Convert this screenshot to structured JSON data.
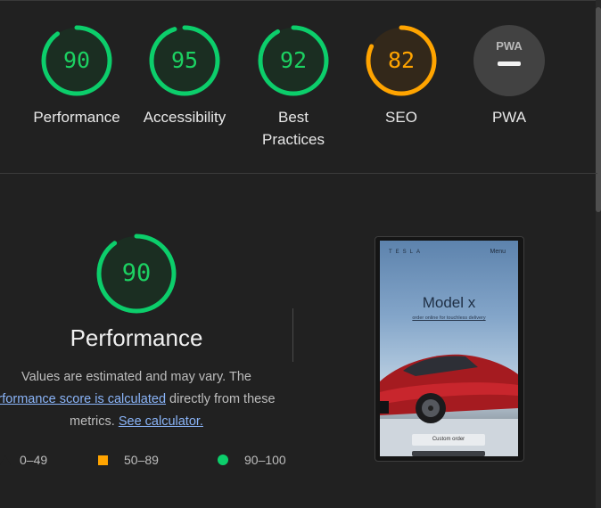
{
  "categories": [
    {
      "label": "Performance",
      "score": "90",
      "value": 90,
      "color": "#0cce6b"
    },
    {
      "label": "Accessibility",
      "score": "95",
      "value": 95,
      "color": "#0cce6b"
    },
    {
      "label": "Best\nPractices",
      "label_line1": "Best",
      "label_line2": "Practices",
      "score": "92",
      "value": 92,
      "color": "#0cce6b"
    },
    {
      "label": "SEO",
      "score": "82",
      "value": 82,
      "color": "#ffa400"
    },
    {
      "label": "PWA",
      "badge": "PWA",
      "icon": "pwa-badge-icon"
    }
  ],
  "performance": {
    "score": "90",
    "value": 90,
    "title": "Performance",
    "desc_line1": "Values are estimated and may vary. The",
    "link_score": "rformance score is calculated",
    "desc_line2_rest": " directly from these",
    "desc_line3_start": "metrics. ",
    "link_calculator": "See calculator."
  },
  "legend": [
    {
      "label": "0–49",
      "icon": "fail-triangle-icon",
      "color": "#ff4e42"
    },
    {
      "label": "50–89",
      "icon": "average-square-icon",
      "color": "#ffa400"
    },
    {
      "label": "90–100",
      "icon": "pass-circle-icon",
      "color": "#0cce6b"
    }
  ],
  "screenshot": {
    "logo": "TESLA",
    "menu": "Menu",
    "title": "Model x",
    "subtitle": "order online for touchless delivery",
    "button": "Custom order"
  }
}
